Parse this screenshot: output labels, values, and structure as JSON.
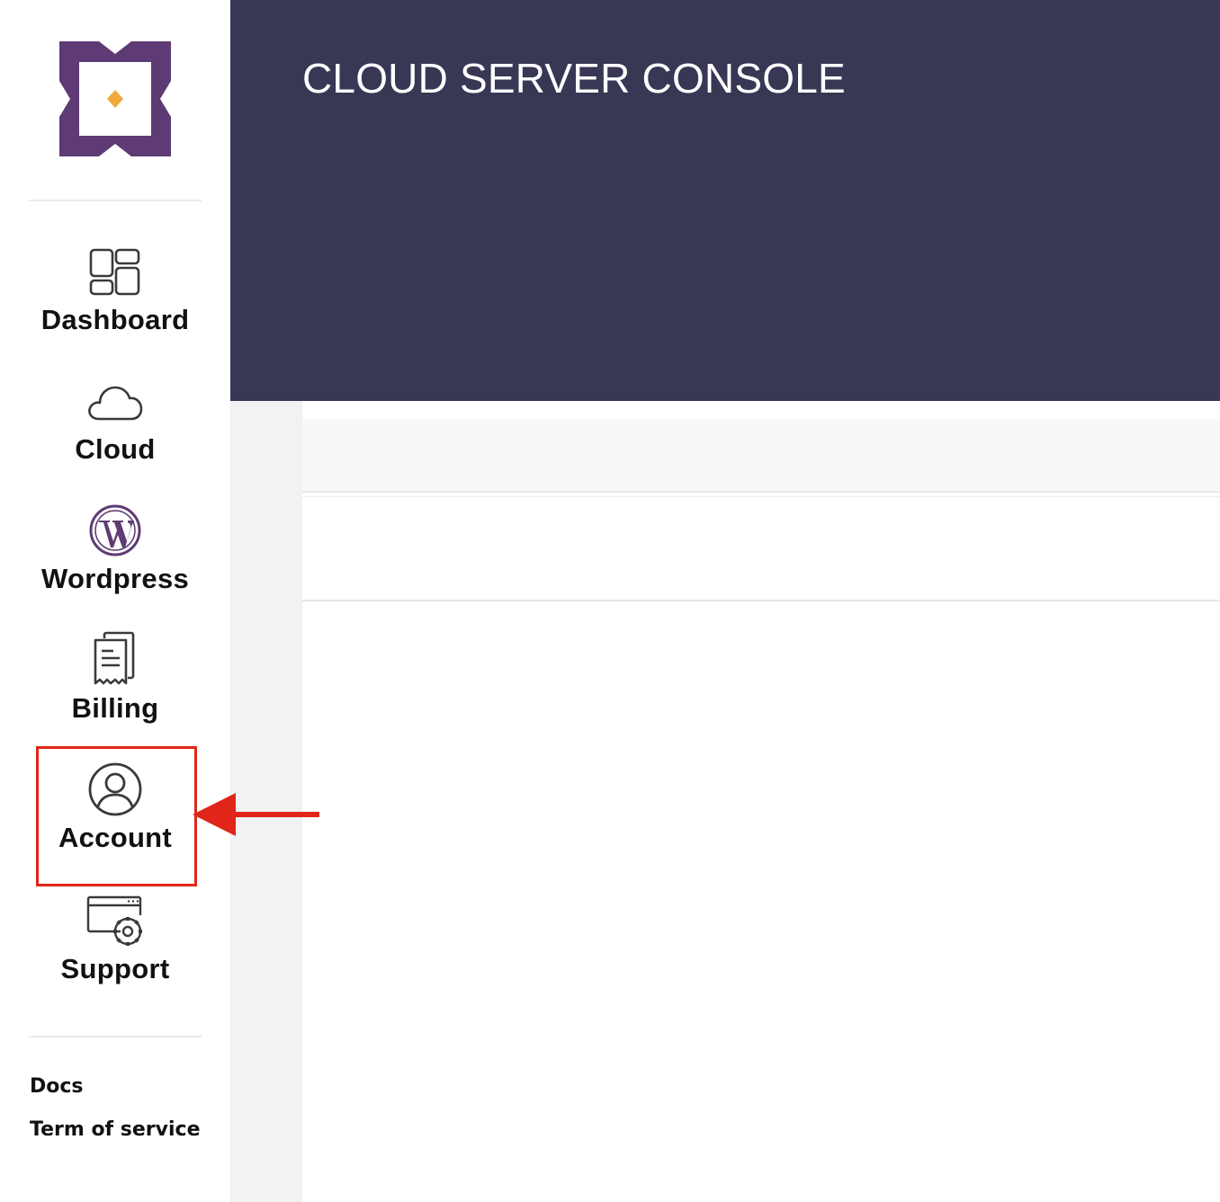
{
  "header": {
    "title": "CLOUD SERVER CONSOLE"
  },
  "sidebar": {
    "items": [
      {
        "label": "Dashboard",
        "icon": "dashboard-icon"
      },
      {
        "label": "Cloud",
        "icon": "cloud-icon"
      },
      {
        "label": "Wordpress",
        "icon": "wordpress-icon"
      },
      {
        "label": "Billing",
        "icon": "billing-icon"
      },
      {
        "label": "Account",
        "icon": "account-icon"
      },
      {
        "label": "Support",
        "icon": "support-icon"
      }
    ],
    "footer_links": [
      "Docs",
      "Term of service"
    ]
  },
  "colors": {
    "header_bg": "#383754",
    "logo_purple": "#5e3b74",
    "logo_diamond": "#f0a93a",
    "wordpress_purple": "#5e3b74",
    "annotation_red": "#e02619"
  },
  "annotation": {
    "highlighted_item": "Account"
  }
}
